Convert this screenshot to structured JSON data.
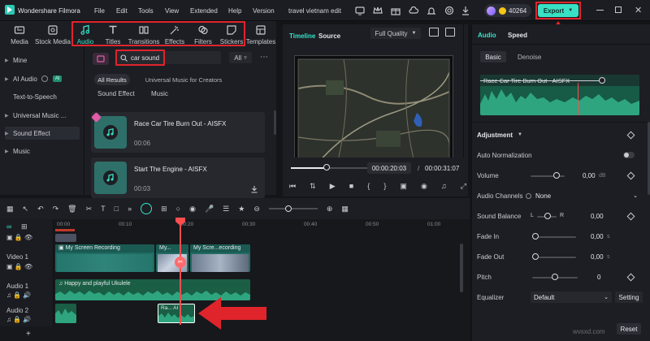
{
  "app": {
    "name": "Wondershare Filmora",
    "project_title": "travel vietnam edit",
    "coins": "40264"
  },
  "menu": [
    "File",
    "Edit",
    "Tools",
    "View",
    "Extended",
    "Help",
    "Version"
  ],
  "export_label": "Export",
  "media_tabs": [
    {
      "label": "Media",
      "icon": "media-icon"
    },
    {
      "label": "Stock Media",
      "icon": "stock-media-icon"
    },
    {
      "label": "Audio",
      "icon": "audio-icon"
    },
    {
      "label": "Titles",
      "icon": "titles-icon"
    },
    {
      "label": "Transitions",
      "icon": "transitions-icon"
    },
    {
      "label": "Effects",
      "icon": "effects-icon"
    },
    {
      "label": "Filters",
      "icon": "filters-icon"
    },
    {
      "label": "Stickers",
      "icon": "stickers-icon"
    },
    {
      "label": "Templates",
      "icon": "templates-icon"
    }
  ],
  "sidebar": {
    "items": [
      {
        "label": "Mine"
      },
      {
        "label": "AI Audio",
        "badge": "AI"
      },
      {
        "label": "Text-to-Speech"
      },
      {
        "label": "Universal Music ..."
      },
      {
        "label": "Sound Effect"
      },
      {
        "label": "Music"
      }
    ]
  },
  "search": {
    "value": "car sound",
    "filter_label": "All"
  },
  "filters": {
    "all_results": "All Results",
    "universal_music": "Universal Music for Creators",
    "sound_effect": "Sound Effect",
    "music": "Music"
  },
  "results": [
    {
      "title": "Race Car Tire Burn Out - AISFX",
      "duration": "00:06"
    },
    {
      "title": "Start The Engine - AISFX",
      "duration": "00:03"
    }
  ],
  "preview": {
    "tab_timeline": "Timeline",
    "tab_source": "Source",
    "quality": "Full Quality",
    "current_time": "00:00:20:03",
    "separator": "/",
    "total_time": "00:00:31:07"
  },
  "right_panel": {
    "tab_audio": "Audio",
    "tab_speed": "Speed",
    "sub_basic": "Basic",
    "sub_denoise": "Denoise",
    "clip_name": "Race Car Tire Burn Out - AISFX",
    "adjustment": "Adjustment",
    "auto_normalization": "Auto Normalization",
    "volume_label": "Volume",
    "volume_value": "0,00",
    "volume_unit": "dB",
    "channels_label": "Audio Channels",
    "channels_value": "None",
    "balance_label": "Sound Balance",
    "balance_l": "L",
    "balance_r": "R",
    "balance_value": "0,00",
    "fade_in_label": "Fade In",
    "fade_in_value": "0,00",
    "fade_in_unit": "s",
    "fade_out_label": "Fade Out",
    "fade_out_value": "0,00",
    "fade_out_unit": "s",
    "pitch_label": "Pitch",
    "pitch_value": "0",
    "equalizer_label": "Equalizer",
    "equalizer_value": "Default",
    "equalizer_setting": "Setting",
    "reset_label": "Reset"
  },
  "timeline": {
    "ruler": [
      "00:00",
      "00:10",
      "00:20",
      "00:30",
      "00:40",
      "00:50",
      "01:00"
    ],
    "tracks": {
      "video1": "Video 1",
      "audio1": "Audio 1",
      "audio2": "Audio 2"
    },
    "clips": {
      "screen1": "My Screen Recording",
      "screen2": "My...",
      "screen3": "My Scre...ecording",
      "audio_music": "Happy and playful Ukulele",
      "audio_sfx": "Ra... AI"
    }
  },
  "watermark": "wvsxd.com",
  "colors": {
    "accent": "#35e3c9",
    "annotation_red": "#e0242c",
    "export_bg": "#38e0c4",
    "playhead": "#ff4d4f"
  }
}
